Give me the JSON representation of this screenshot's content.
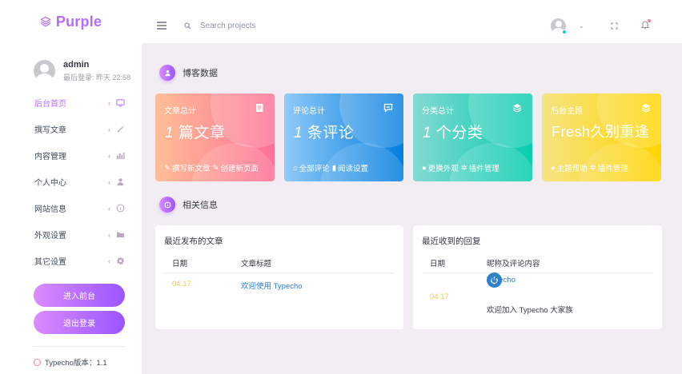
{
  "brand": {
    "name": "Purple"
  },
  "profile": {
    "name": "admin",
    "last_login": "最后登录: 昨天 22:58"
  },
  "sidebar": {
    "items": [
      {
        "label": "后台首页",
        "active": true
      },
      {
        "label": "撰写文章"
      },
      {
        "label": "内容管理"
      },
      {
        "label": "个人中心"
      },
      {
        "label": "网站信息"
      },
      {
        "label": "外观设置"
      },
      {
        "label": "其它设置"
      }
    ],
    "front_button": "进入前台",
    "logout_button": "退出登录",
    "version": "Typecho版本：1.1"
  },
  "topbar": {
    "search_placeholder": "Search projects"
  },
  "sections": {
    "blog_data": "博客数据",
    "related_info": "相关信息"
  },
  "cards": [
    {
      "label": "文章总计",
      "value_num": "1",
      "value_text": "篇文章",
      "links": [
        "撰写新文章",
        "创建新页面"
      ],
      "color_from": "#ffbf96",
      "color_to": "#fe7096"
    },
    {
      "label": "评论总计",
      "value_num": "1",
      "value_text": "条评论",
      "links": [
        "全部评论",
        "阅读设置"
      ],
      "color_from": "#90caf9",
      "color_to": "#047edf"
    },
    {
      "label": "分类总计",
      "value_num": "1",
      "value_text": "个分类",
      "links": [
        "更换外观",
        "插件管理"
      ],
      "color_from": "#84d9d2",
      "color_to": "#07cdae"
    },
    {
      "label": "后台主题",
      "value_num": "",
      "value_text": "Fresh久别重逢",
      "links": [
        "主题帮助",
        "插件管理"
      ],
      "color_from": "#f6e384",
      "color_to": "#ffd500"
    }
  ],
  "recent_posts": {
    "title": "最近发布的文章",
    "headers": [
      "日期",
      "文章标题"
    ],
    "rows": [
      {
        "date": "04.17",
        "title": "欢迎使用 Typecho"
      }
    ]
  },
  "recent_replies": {
    "title": "最近收到的回复",
    "headers": [
      "日期",
      "昵称及评论内容"
    ],
    "rows": [
      {
        "date": "04.17",
        "author": "Typecho",
        "content": "欢迎加入 Typecho 大家族"
      }
    ]
  },
  "colors": {
    "accent": "#b66dff",
    "date": "#f5c542",
    "link": "#2d7bd8"
  }
}
